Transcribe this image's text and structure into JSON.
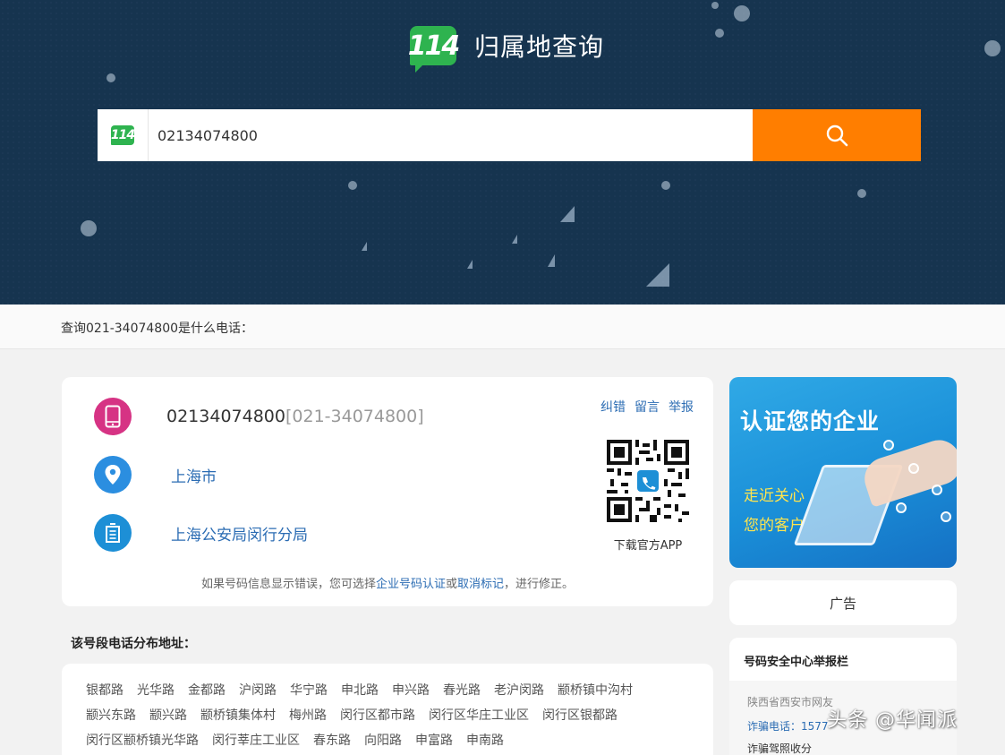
{
  "header": {
    "logo_text": "114",
    "title": "归属地查询"
  },
  "search": {
    "logo_text": "114",
    "value": "02134074800",
    "button_icon": "search-icon"
  },
  "breadcrumb": {
    "text": "查询021-34074800是什么电话："
  },
  "result": {
    "number": "02134074800",
    "number_formatted": "[021-34074800]",
    "city": "上海市",
    "owner": "上海公安局闵行分局",
    "actions": [
      "纠错",
      "留言",
      "举报"
    ],
    "qr_label": "下载官方APP",
    "note_prefix": "如果号码信息显示错误，您可选择",
    "note_link1": "企业号码认证",
    "note_mid": "或",
    "note_link2": "取消标记",
    "note_suffix": "，进行修正。",
    "icons": [
      "phone-icon",
      "location-pin-icon",
      "building-icon"
    ],
    "colors": {
      "phone_icon_bg": "#d63384",
      "loc_icon_bg": "#2b8ee0",
      "org_icon_bg": "#1d8fd6"
    }
  },
  "roads": {
    "title": "该号段电话分布地址：",
    "items": [
      "银都路",
      "光华路",
      "金都路",
      "沪闵路",
      "华宁路",
      "申北路",
      "申兴路",
      "春光路",
      "老沪闵路",
      "颛桥镇中沟村",
      "颛兴东路",
      "颛兴路",
      "颛桥镇集体村",
      "梅州路",
      "闵行区都市路",
      "闵行区华庄工业区",
      "闵行区银都路",
      "闵行区颛桥镇光华路",
      "闵行莘庄工业区",
      "春东路",
      "向阳路",
      "申富路",
      "申南路"
    ]
  },
  "ad": {
    "title": "认证您的企业",
    "line1": "走近关心",
    "line2": "您的客户",
    "label": "广告"
  },
  "report": {
    "title": "号码安全中心举报栏",
    "user": "陕西省西安市网友",
    "phone_label": "诈骗电话：1577",
    "content": "诈骗驾照收分"
  },
  "watermark": "头条 @华闻派",
  "colors": {
    "accent": "#ff7e00",
    "header_bg": "#16344f",
    "link": "#2b6cb3",
    "brand_green": "#2eb34f"
  }
}
